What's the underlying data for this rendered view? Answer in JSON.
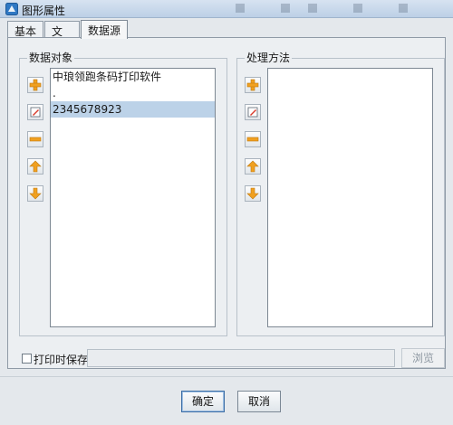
{
  "window": {
    "title": "图形属性"
  },
  "tabs": [
    {
      "label": "基本"
    },
    {
      "label": "文字"
    },
    {
      "label": "数据源"
    }
  ],
  "data_objects": {
    "title": "数据对象",
    "items": [
      "中琅领跑条码打印软件",
      ".",
      "2345678923"
    ],
    "selected_index": 2
  },
  "processing": {
    "title": "处理方法",
    "items": []
  },
  "side_buttons": [
    "add-icon",
    "edit-icon",
    "remove-icon",
    "move-up-icon",
    "move-down-icon"
  ],
  "print_save": {
    "label": "打印时保存",
    "checked": false,
    "path_value": ""
  },
  "browse_label": "浏览",
  "footer": {
    "ok_label": "确定",
    "cancel_label": "取消"
  },
  "colors": {
    "selection": "#bcd2e8",
    "icon_orange": "#f0a020"
  }
}
